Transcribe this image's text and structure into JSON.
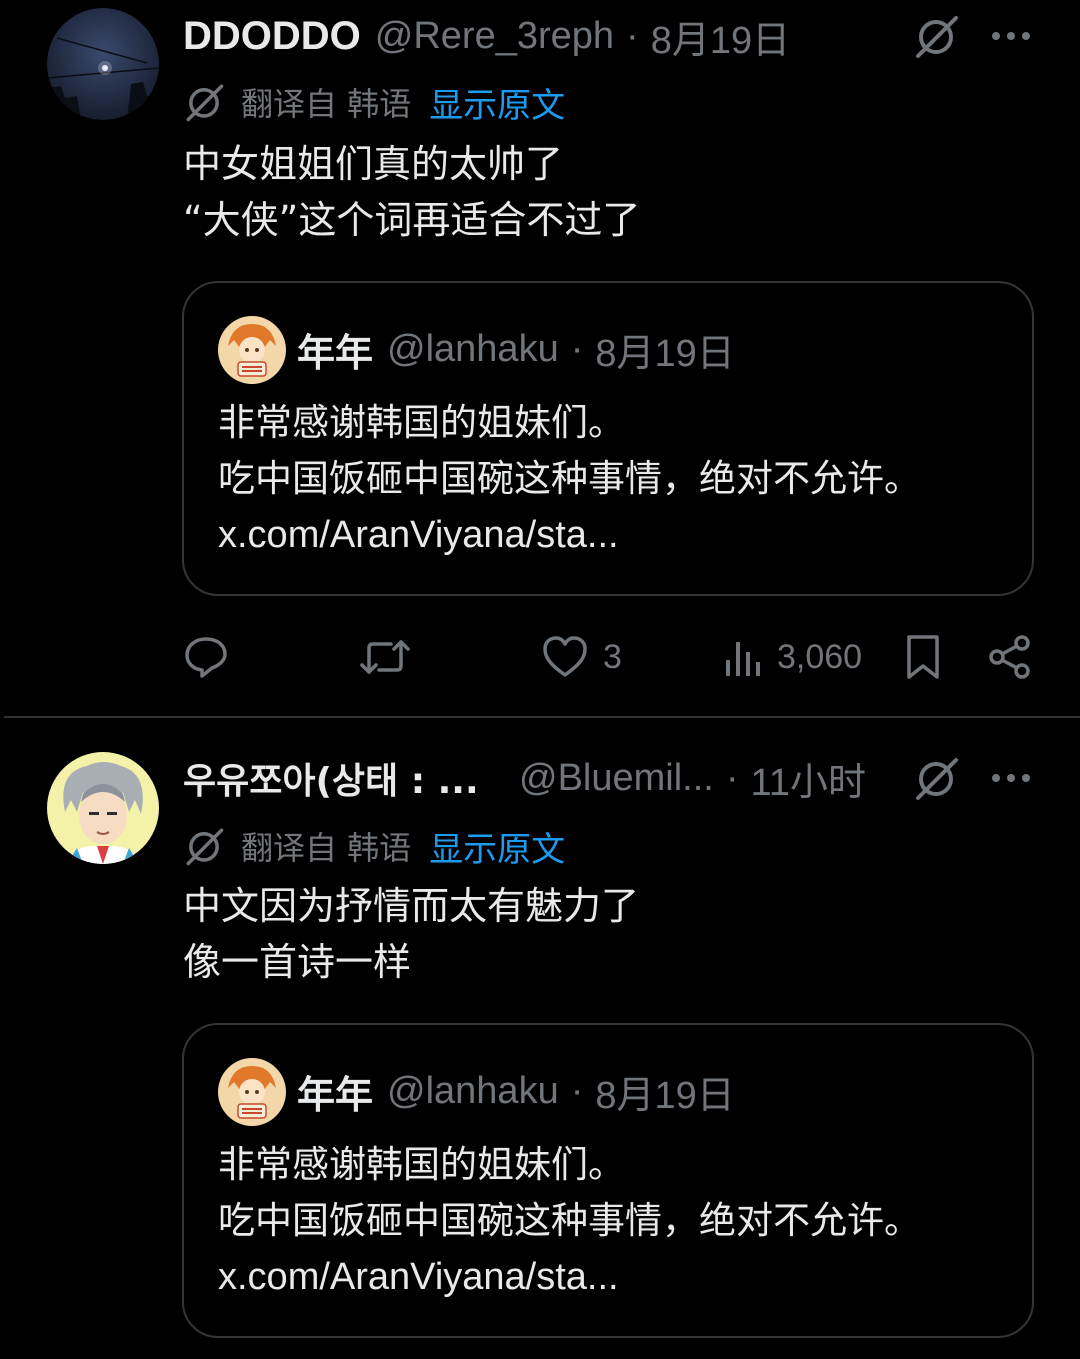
{
  "tweets": [
    {
      "display_name": "DDODDO",
      "handle": "@Rere_3reph",
      "separator": "·",
      "time": "8月19日",
      "translated_from": "翻译自 韩语",
      "show_original": "显示原文",
      "body_lines": [
        "中女姐姐们真的太帅了",
        "“大侠”这个词再适合不过了"
      ],
      "quote": {
        "display_name": "年年",
        "handle": "@lanhaku",
        "separator": "·",
        "time": "8月19日",
        "body_lines": [
          "非常感谢韩国的姐妹们。",
          "吃中国饭砸中国碗这种事情，绝对不允许。"
        ],
        "link": "x.com/AranViyana/sta..."
      },
      "actions": {
        "reply_icon": "reply-icon",
        "retweet_icon": "retweet-icon",
        "like_icon": "heart-icon",
        "like_count": "3",
        "views_icon": "views-icon",
        "views_count": "3,060",
        "bookmark_icon": "bookmark-icon",
        "share_icon": "share-icon"
      }
    },
    {
      "display_name": "우유쪼아(상태 : ...",
      "handle": "@Bluemil...",
      "separator": "·",
      "time": "11小时",
      "translated_from": "翻译自 韩语",
      "show_original": "显示原文",
      "body_lines": [
        "中文因为抒情而太有魅力了",
        "像一首诗一样"
      ],
      "quote": {
        "display_name": "年年",
        "handle": "@lanhaku",
        "separator": "·",
        "time": "8月19日",
        "body_lines": [
          "非常感谢韩国的姐妹们。",
          "吃中国饭砸中国碗这种事情，绝对不允许。"
        ],
        "link": "x.com/AranViyana/sta..."
      }
    }
  ],
  "colors": {
    "background": "#000000",
    "text": "#e7e9ea",
    "secondary": "#71767b",
    "link": "#1d9bf0",
    "border": "#333639"
  }
}
